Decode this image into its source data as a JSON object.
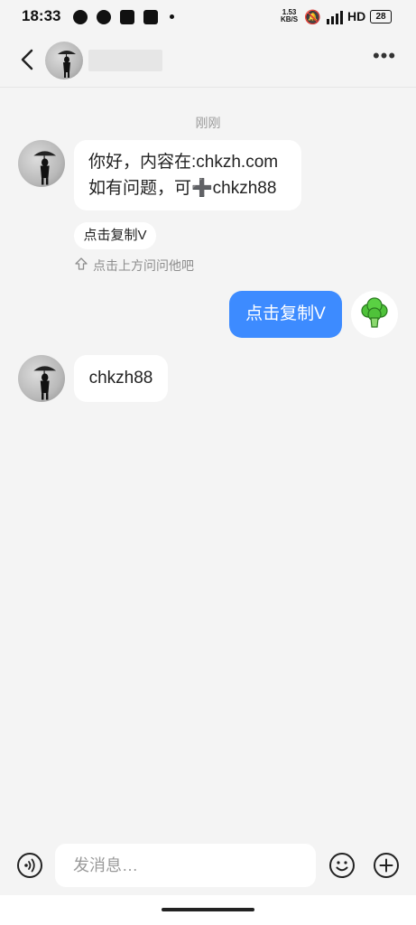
{
  "status_bar": {
    "time": "18:33",
    "net_speed_value": "1.53",
    "net_speed_unit": "KB/S",
    "network": "HD",
    "battery": "28"
  },
  "header": {
    "contact_name": ""
  },
  "chat": {
    "timestamp": "刚刚",
    "messages": [
      {
        "from": "other",
        "lines": [
          "你好，内容在:chkzh.com",
          "如有问题，可➕chkzh88"
        ]
      },
      {
        "from": "other_chip",
        "text": "点击复制V"
      },
      {
        "from": "hint",
        "text": "点击上方问问他吧"
      },
      {
        "from": "me",
        "text": "点击复制V"
      },
      {
        "from": "other",
        "text": "chkzh88"
      }
    ]
  },
  "input": {
    "placeholder": "发消息…"
  },
  "colors": {
    "accent": "#3d8bff",
    "background": "#f4f4f4",
    "bubble": "#ffffff"
  }
}
